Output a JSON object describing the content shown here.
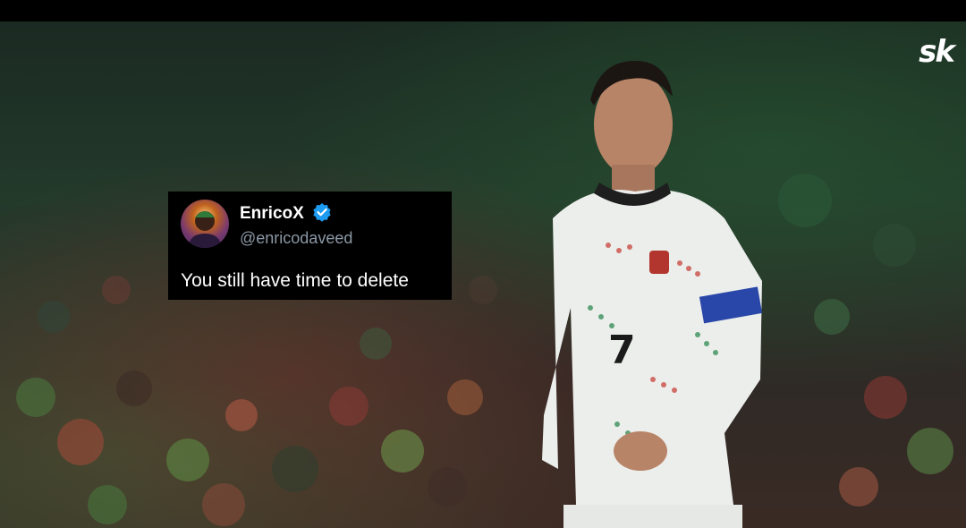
{
  "brand": {
    "logo_text": "sk"
  },
  "tweet": {
    "display_name": "EnricoX",
    "handle": "@enricodaveed",
    "text": "You still have time to delete",
    "verified_color": "#1d9bf0"
  },
  "player": {
    "shirt_number": "7"
  }
}
